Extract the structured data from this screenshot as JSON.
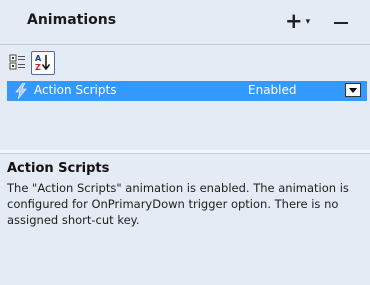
{
  "header": {
    "title": "Animations",
    "add_label": "+",
    "add_caret": "▾",
    "remove_icon": "minus-icon"
  },
  "toolbar": {
    "categorized_icon": "categorized-icon",
    "sort_icon": "sort-alphabetical-icon"
  },
  "property_grid": {
    "selected_row": {
      "name": "Action Scripts",
      "value": "Enabled",
      "icon": "lightning-icon"
    },
    "selection_color": "#3399ff"
  },
  "description": {
    "title": "Action Scripts",
    "body": "The \"Action Scripts\" animation is enabled. The animation is configured for OnPrimaryDown trigger option. There is no assigned short-cut key."
  },
  "colors": {
    "panel_bg": "#e4ebf4",
    "selection": "#3399ff"
  }
}
